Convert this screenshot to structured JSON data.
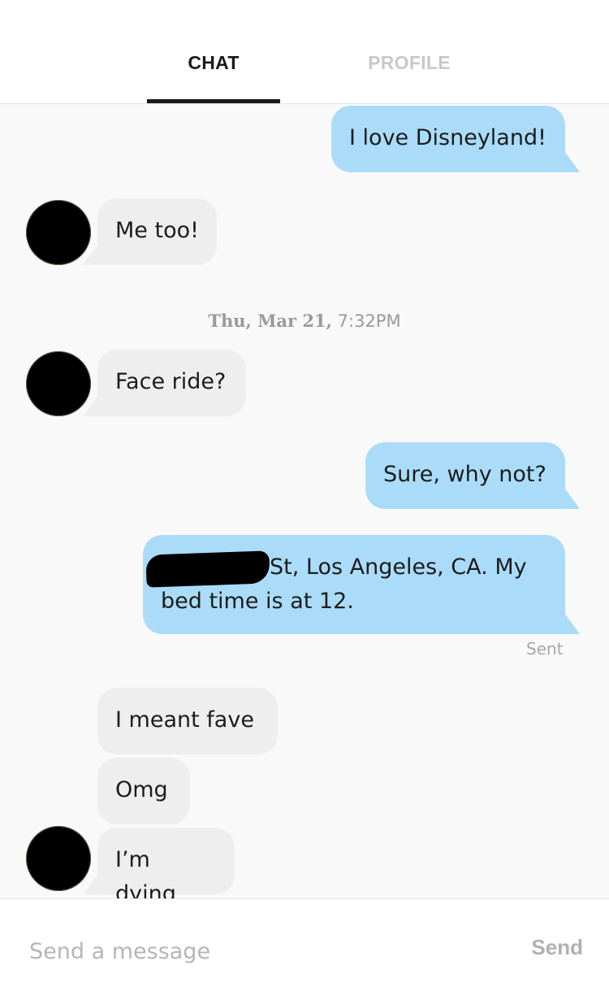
{
  "tabs": {
    "chat": "CHAT",
    "profile": "PROFILE"
  },
  "messages": [
    {
      "direction": "outgoing",
      "text": "I love Disneyland!"
    },
    {
      "direction": "incoming",
      "text": "Me too!"
    },
    {
      "direction": "incoming",
      "text": "Face ride?"
    },
    {
      "direction": "outgoing",
      "text": "Sure, why not?"
    },
    {
      "direction": "outgoing",
      "text_visible": "St, Los Angeles, CA. My bed time is at 12.",
      "redacted_prefix": true
    },
    {
      "direction": "incoming",
      "text": "I meant fave"
    },
    {
      "direction": "incoming",
      "text": "Omg"
    },
    {
      "direction": "incoming",
      "text": "I’m dying"
    }
  ],
  "timestamp": {
    "day": "Thu, Mar 21,",
    "time": "7:32PM"
  },
  "status": {
    "sent": "Sent"
  },
  "composer": {
    "placeholder": "Send a message",
    "send_label": "Send"
  },
  "colors": {
    "outgoing_bubble": "#aadcf9",
    "incoming_bubble": "#eeeeee",
    "active_tab": "#1a1a1a",
    "inactive_tab": "#c9c9c9"
  }
}
